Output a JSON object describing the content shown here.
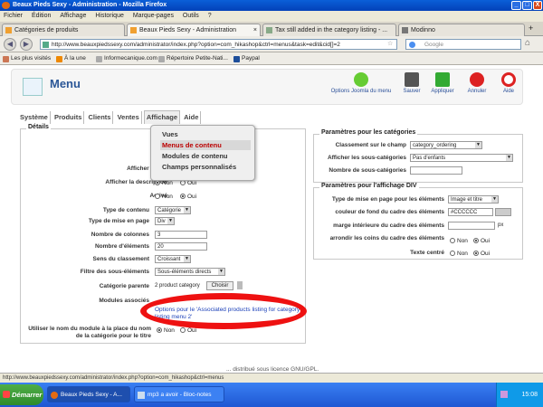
{
  "window": {
    "title": "Beaux Pieds Sexy - Administration - Mozilla Firefox",
    "controls": [
      "_",
      "□",
      "X"
    ]
  },
  "menubar": [
    "Fichier",
    "Édition",
    "Affichage",
    "Historique",
    "Marque-pages",
    "Outils",
    "?"
  ],
  "browser_tabs": [
    {
      "label": "Catégories de produits"
    },
    {
      "label": "Beaux Pieds Sexy - Administration"
    },
    {
      "label": "Tax still added in the category listing - ..."
    },
    {
      "label": "Modinno"
    }
  ],
  "nav": {
    "url": "http://www.beauxpiedssexy.com/administrator/index.php?option=com_hikashop&ctrl=menus&task=edit&cid[]=2",
    "search_placeholder": "Google"
  },
  "bookmarks": [
    "Les plus visités",
    "À la une",
    "Informecanique.com",
    "Répertoire Petite-Nati...",
    "Paypal"
  ],
  "header": {
    "title": "Menu",
    "toolbar": [
      {
        "label": "Options Joomla du menu"
      },
      {
        "label": "Sauver"
      },
      {
        "label": "Appliquer"
      },
      {
        "label": "Annuler"
      },
      {
        "label": "Aide"
      }
    ]
  },
  "tabs": [
    "Système",
    "Produits",
    "Clients",
    "Ventes",
    "Affichage",
    "Aide"
  ],
  "dropdown": {
    "items": [
      "Vues",
      "Menus de contenu",
      "Modules de contenu",
      "Champs personnalisés"
    ],
    "highlighted": "Menus de contenu"
  },
  "details": {
    "legend": "Détails",
    "fields": {
      "nom": "Nom",
      "alias": "Alia",
      "afficher_image": "Afficher l'imag",
      "afficher_description": "Afficher la description",
      "actif": "Activé",
      "type_contenu": "Type de contenu",
      "type_mise_en_page": "Type de mise en page",
      "nombre_colonnes": "Nombre de colonnes",
      "nombre_elements": "Nombre d'éléments",
      "sens_classement": "Sens du classement",
      "filtre_sous_elements": "Filtre des sous-éléments",
      "categorie_parente": "Catégorie parente",
      "modules_associes": "Modules associés",
      "utiliser_nom_module": "Utiliser le nom du module à la place du nom de la catégorie pour le titre"
    },
    "values": {
      "type_contenu": "Catégorie",
      "type_mise_en_page": "Div",
      "nombre_colonnes": "3",
      "nombre_elements": "20",
      "sens_classement": "Croissant",
      "filtre_sous_elements": "Sous-éléments directs",
      "categorie_parente": "2 product category",
      "choose_button": "Choisir",
      "modules_link": "Options pour le 'Associated products listing for category listing menu 2'"
    },
    "radio_non": "Non",
    "radio_oui": "Oui"
  },
  "category_params": {
    "legend": "Paramètres pour les catégories",
    "fields": [
      "Classement sur le champ",
      "Afficher les sous-catégories",
      "Nombre de sous-catégories"
    ],
    "values": {
      "classement": "category_ordering",
      "sous_categories": "Pas d'enfants",
      "nombre": ""
    }
  },
  "div_params": {
    "legend": "Paramètres pour l'affichage DIV",
    "fields": [
      "Type de mise en page pour les éléments",
      "couleur de fond du cadre des éléments",
      "marge intérieure du cadre des éléments",
      "arrondir les coins du cadre des éléments",
      "Texte centré"
    ],
    "values": {
      "type_mise_en_page": "Image et titre",
      "couleur": "#CCCCCC",
      "marge": "",
      "px": "px"
    },
    "radio_non": "Non",
    "radio_oui": "Oui"
  },
  "footer_partial": "... distribué sous licence GNU/GPL.",
  "footer_link": "GNU/GPL",
  "statusbar": "http://www.beauxpiedssexy.com/administrator/index.php?option=com_hikashop&ctrl=menus",
  "taskbar": {
    "start": "Démarrer",
    "tasks": [
      "Beaux Pieds Sexy - A...",
      "mp3 a avoir - Bloc-notes"
    ],
    "clock": "15:08"
  }
}
